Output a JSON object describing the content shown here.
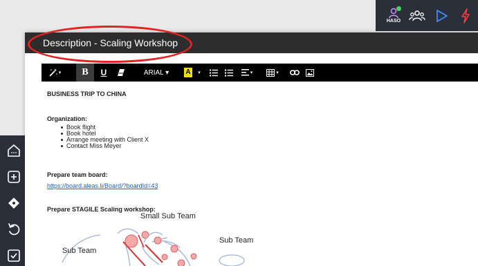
{
  "topbar": {
    "user_initials": "HASO",
    "icons": [
      "user-icon",
      "team-icon",
      "play-icon",
      "flash-icon"
    ],
    "online_color": "#3ddc53"
  },
  "leftnav": {
    "icons": [
      "home-icon",
      "add-icon",
      "diamond-icon",
      "undo-icon",
      "checkbox-icon"
    ]
  },
  "dialog": {
    "title": "Description - Scaling Workshop"
  },
  "toolbar": {
    "bold": "B",
    "underline": "U",
    "font_name": "ARIAL ▾",
    "highlight": "A",
    "magic_caret": "▾",
    "align_caret": "▾",
    "table_caret": "▾",
    "color_caret": "▾"
  },
  "content": {
    "heading": "BUSINESS TRIP TO CHINA",
    "organization_label": "Organization:",
    "organization_items": [
      "Book flight",
      "Book hotel",
      "Arrange meeting with Client X",
      "Contact Miss Meyer"
    ],
    "team_board_label": "Prepare team board:",
    "team_board_link": "https://board.aleas.li/Board/?boardId=43",
    "workshop_label": "Prepare STAGILE Scaling workshop:",
    "sketch": {
      "small_sub_team": "Small Sub Team",
      "sub_team": "Sub Team",
      "sub_team_left": "Sub Team"
    }
  },
  "colors": {
    "dark_bar": "#2b2f3a",
    "title_bar": "#2d2d2d",
    "annotation": "#e32222",
    "link": "#1b5cc9",
    "highlight_yellow": "#f0e000"
  }
}
